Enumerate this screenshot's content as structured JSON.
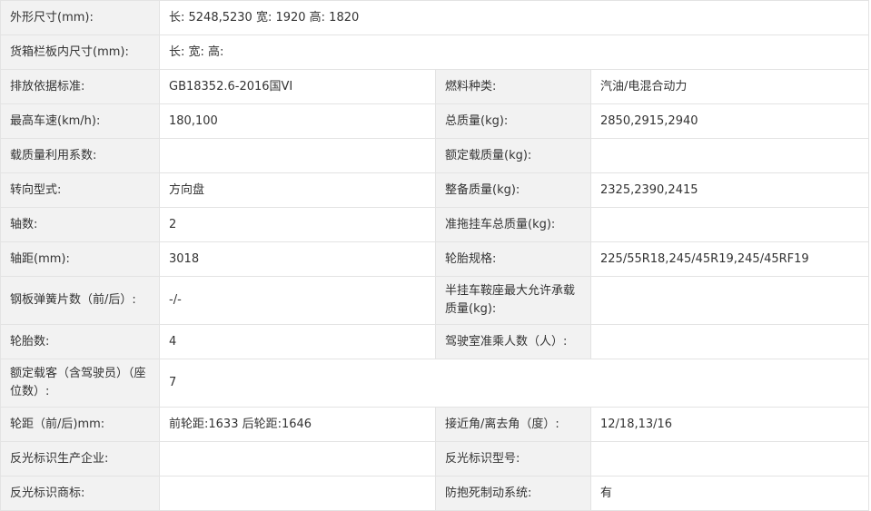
{
  "rows": [
    {
      "cells": [
        {
          "label": "外形尺寸(mm):"
        },
        {
          "value": "长: 5248,5230 宽: 1920 高: 1820",
          "span": 3
        }
      ]
    },
    {
      "cells": [
        {
          "label": "货箱栏板内尺寸(mm):"
        },
        {
          "value": "长:  宽:  高:",
          "span": 3
        }
      ]
    },
    {
      "cells": [
        {
          "label": "排放依据标准:"
        },
        {
          "value": "GB18352.6-2016国VI"
        },
        {
          "label": "燃料种类:"
        },
        {
          "value": "汽油/电混合动力"
        }
      ]
    },
    {
      "cells": [
        {
          "label": "最高车速(km/h):"
        },
        {
          "value": "180,100"
        },
        {
          "label": "总质量(kg):"
        },
        {
          "value": "2850,2915,2940"
        }
      ]
    },
    {
      "cells": [
        {
          "label": "载质量利用系数:"
        },
        {
          "value": ""
        },
        {
          "label": "额定载质量(kg):"
        },
        {
          "value": ""
        }
      ]
    },
    {
      "cells": [
        {
          "label": "转向型式:"
        },
        {
          "value": "方向盘"
        },
        {
          "label": "整备质量(kg):"
        },
        {
          "value": "2325,2390,2415"
        }
      ]
    },
    {
      "cells": [
        {
          "label": "轴数:"
        },
        {
          "value": "2"
        },
        {
          "label": "准拖挂车总质量(kg):"
        },
        {
          "value": ""
        }
      ]
    },
    {
      "cells": [
        {
          "label": "轴距(mm):"
        },
        {
          "value": "3018"
        },
        {
          "label": "轮胎规格:"
        },
        {
          "value": "225/55R18,245/45R19,245/45RF19"
        }
      ]
    },
    {
      "tall": true,
      "cells": [
        {
          "label": "钢板弹簧片数（前/后）:"
        },
        {
          "value": "-/-"
        },
        {
          "label": "半挂车鞍座最大允许承载质量(kg):"
        },
        {
          "value": ""
        }
      ]
    },
    {
      "cells": [
        {
          "label": "轮胎数:"
        },
        {
          "value": "4"
        },
        {
          "label": "驾驶室准乘人数（人）:"
        },
        {
          "value": ""
        }
      ]
    },
    {
      "tall": true,
      "cells": [
        {
          "label": "额定载客（含驾驶员）（座位数）:"
        },
        {
          "value": "7",
          "span": 3
        }
      ]
    },
    {
      "cells": [
        {
          "label": "轮距（前/后)mm:"
        },
        {
          "value": "前轮距:1633 后轮距:1646"
        },
        {
          "label": "接近角/离去角（度）:"
        },
        {
          "value": "12/18,13/16"
        }
      ]
    },
    {
      "cells": [
        {
          "label": "反光标识生产企业:"
        },
        {
          "value": ""
        },
        {
          "label": "反光标识型号:"
        },
        {
          "value": ""
        }
      ]
    },
    {
      "cells": [
        {
          "label": "反光标识商标:"
        },
        {
          "value": ""
        },
        {
          "label": "防抱死制动系统:"
        },
        {
          "value": "有"
        }
      ]
    }
  ]
}
